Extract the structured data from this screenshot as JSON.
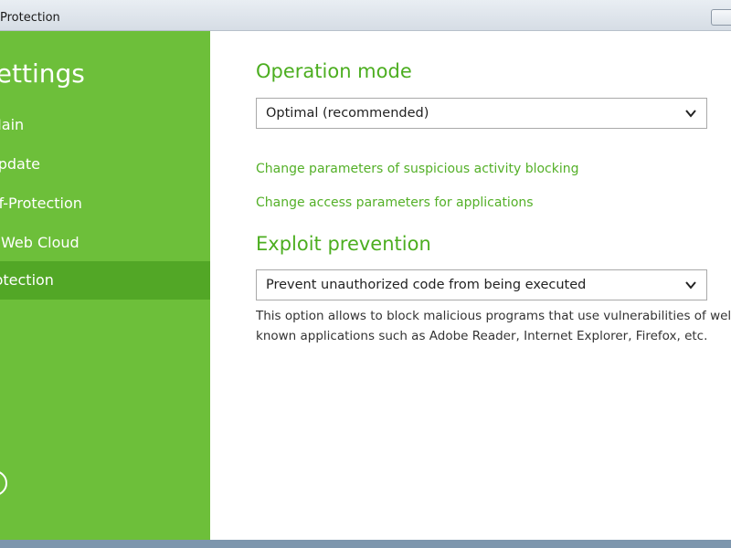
{
  "window": {
    "title": "Protection"
  },
  "sidebar": {
    "title": "Settings",
    "items": [
      {
        "label": "Main"
      },
      {
        "label": "Update"
      },
      {
        "label": "Self-Protection"
      },
      {
        "label": "Web Cloud"
      },
      {
        "label": "Protection"
      }
    ]
  },
  "main": {
    "operation_mode": {
      "title": "Operation mode",
      "selected": "Optimal (recommended)"
    },
    "links": [
      {
        "label": "Change parameters of suspicious activity blocking"
      },
      {
        "label": "Change access parameters for applications"
      }
    ],
    "exploit_prevention": {
      "title": "Exploit prevention",
      "selected": "Prevent unauthorized code from being executed",
      "description_line1": "This option allows to block malicious programs that use vulnerabilities of well-",
      "description_line2": "known applications such as Adobe Reader, Internet Explorer, Firefox, etc."
    }
  },
  "colors": {
    "sidebar_bg": "#6dbf3a",
    "sidebar_active": "#52a726",
    "accent_green": "#4cae20"
  },
  "icons": {
    "dropdown": "chevron-down-icon",
    "sidebar_bottom": "circle-icon"
  }
}
